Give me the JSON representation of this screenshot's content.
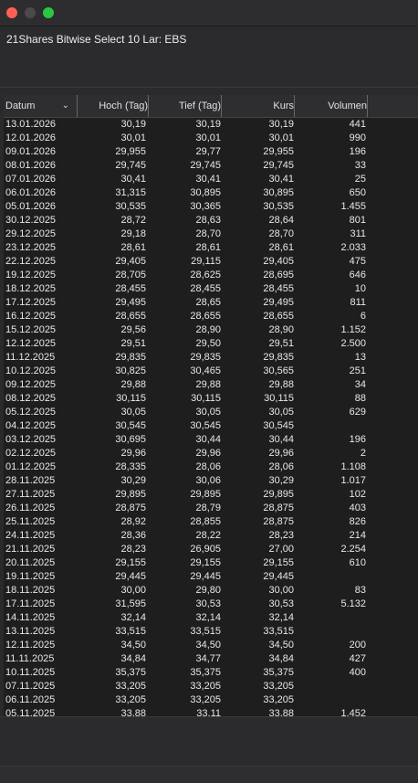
{
  "window": {
    "title": "21Shares Bitwise Select 10 Lar: EBS"
  },
  "table": {
    "columns": [
      "Datum",
      "Hoch (Tag)",
      "Tief (Tag)",
      "Kurs",
      "Volumen"
    ],
    "sort_icon": "chevron-down-icon",
    "rows": [
      [
        "13.01.2026",
        "30,19",
        "30,19",
        "30,19",
        "441"
      ],
      [
        "12.01.2026",
        "30,01",
        "30,01",
        "30,01",
        "990"
      ],
      [
        "09.01.2026",
        "29,955",
        "29,77",
        "29,955",
        "196"
      ],
      [
        "08.01.2026",
        "29,745",
        "29,745",
        "29,745",
        "33"
      ],
      [
        "07.01.2026",
        "30,41",
        "30,41",
        "30,41",
        "25"
      ],
      [
        "06.01.2026",
        "31,315",
        "30,895",
        "30,895",
        "650"
      ],
      [
        "05.01.2026",
        "30,535",
        "30,365",
        "30,535",
        "1.455"
      ],
      [
        "30.12.2025",
        "28,72",
        "28,63",
        "28,64",
        "801"
      ],
      [
        "29.12.2025",
        "29,18",
        "28,70",
        "28,70",
        "311"
      ],
      [
        "23.12.2025",
        "28,61",
        "28,61",
        "28,61",
        "2.033"
      ],
      [
        "22.12.2025",
        "29,405",
        "29,115",
        "29,405",
        "475"
      ],
      [
        "19.12.2025",
        "28,705",
        "28,625",
        "28,695",
        "646"
      ],
      [
        "18.12.2025",
        "28,455",
        "28,455",
        "28,455",
        "10"
      ],
      [
        "17.12.2025",
        "29,495",
        "28,65",
        "29,495",
        "811"
      ],
      [
        "16.12.2025",
        "28,655",
        "28,655",
        "28,655",
        "6"
      ],
      [
        "15.12.2025",
        "29,56",
        "28,90",
        "28,90",
        "1.152"
      ],
      [
        "12.12.2025",
        "29,51",
        "29,50",
        "29,51",
        "2.500"
      ],
      [
        "11.12.2025",
        "29,835",
        "29,835",
        "29,835",
        "13"
      ],
      [
        "10.12.2025",
        "30,825",
        "30,465",
        "30,565",
        "251"
      ],
      [
        "09.12.2025",
        "29,88",
        "29,88",
        "29,88",
        "34"
      ],
      [
        "08.12.2025",
        "30,115",
        "30,115",
        "30,115",
        "88"
      ],
      [
        "05.12.2025",
        "30,05",
        "30,05",
        "30,05",
        "629"
      ],
      [
        "04.12.2025",
        "30,545",
        "30,545",
        "30,545",
        ""
      ],
      [
        "03.12.2025",
        "30,695",
        "30,44",
        "30,44",
        "196"
      ],
      [
        "02.12.2025",
        "29,96",
        "29,96",
        "29,96",
        "2"
      ],
      [
        "01.12.2025",
        "28,335",
        "28,06",
        "28,06",
        "1.108"
      ],
      [
        "28.11.2025",
        "30,29",
        "30,06",
        "30,29",
        "1.017"
      ],
      [
        "27.11.2025",
        "29,895",
        "29,895",
        "29,895",
        "102"
      ],
      [
        "26.11.2025",
        "28,875",
        "28,79",
        "28,875",
        "403"
      ],
      [
        "25.11.2025",
        "28,92",
        "28,855",
        "28,875",
        "826"
      ],
      [
        "24.11.2025",
        "28,36",
        "28,22",
        "28,23",
        "214"
      ],
      [
        "21.11.2025",
        "28,23",
        "26,905",
        "27,00",
        "2.254"
      ],
      [
        "20.11.2025",
        "29,155",
        "29,155",
        "29,155",
        "610"
      ],
      [
        "19.11.2025",
        "29,445",
        "29,445",
        "29,445",
        ""
      ],
      [
        "18.11.2025",
        "30,00",
        "29,80",
        "30,00",
        "83"
      ],
      [
        "17.11.2025",
        "31,595",
        "30,53",
        "30,53",
        "5.132"
      ],
      [
        "14.11.2025",
        "32,14",
        "32,14",
        "32,14",
        ""
      ],
      [
        "13.11.2025",
        "33,515",
        "33,515",
        "33,515",
        ""
      ],
      [
        "12.11.2025",
        "34,50",
        "34,50",
        "34,50",
        "200"
      ],
      [
        "11.11.2025",
        "34,84",
        "34,77",
        "34,84",
        "427"
      ],
      [
        "10.11.2025",
        "35,375",
        "35,375",
        "35,375",
        "400"
      ],
      [
        "07.11.2025",
        "33,205",
        "33,205",
        "33,205",
        ""
      ],
      [
        "06.11.2025",
        "33,205",
        "33,205",
        "33,205",
        ""
      ],
      [
        "05.11.2025",
        "33,88",
        "33,11",
        "33,88",
        "1.452"
      ]
    ]
  }
}
